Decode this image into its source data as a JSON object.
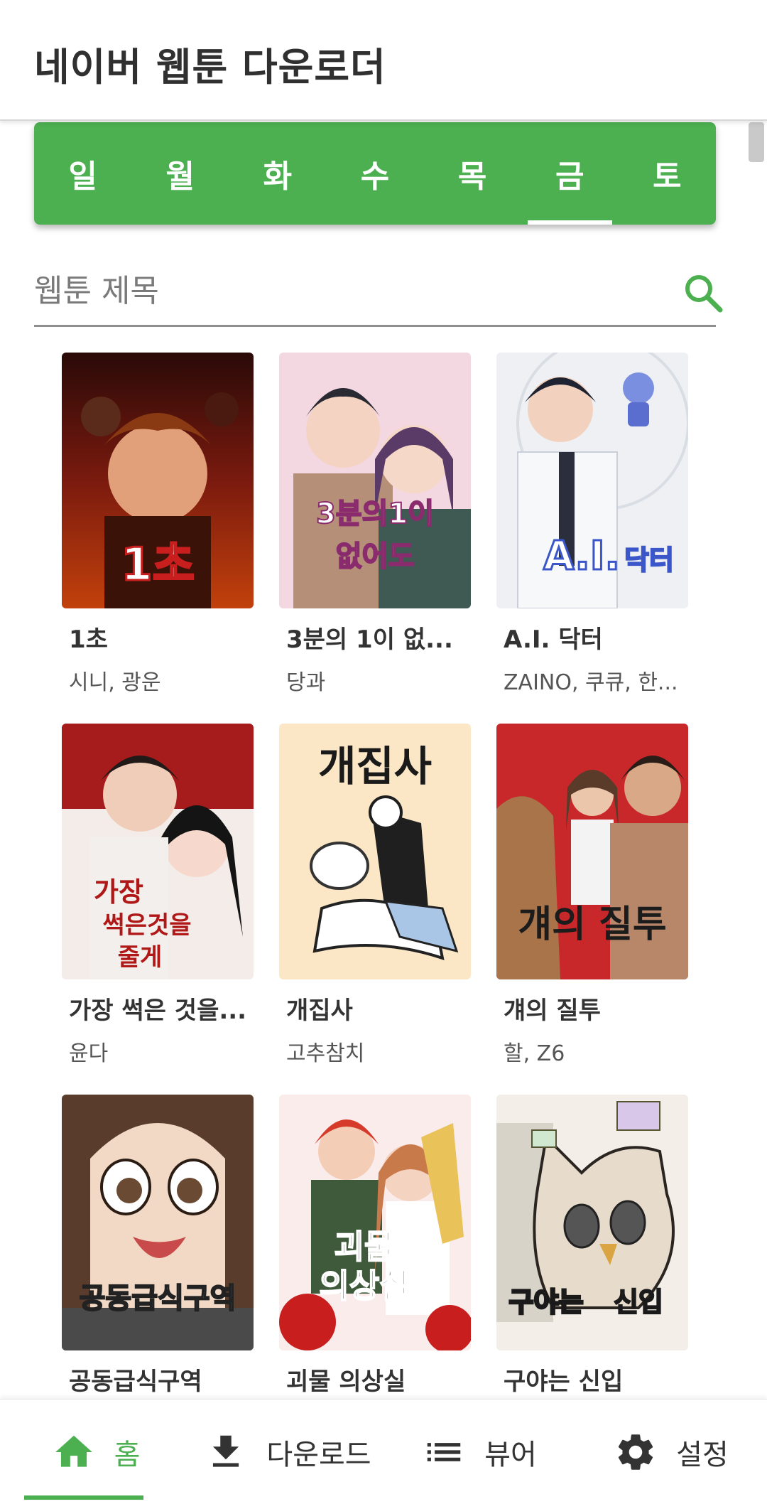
{
  "app_title": "네이버 웹툰 다운로더",
  "day_tabs": [
    {
      "label": "일"
    },
    {
      "label": "월"
    },
    {
      "label": "화"
    },
    {
      "label": "수"
    },
    {
      "label": "목"
    },
    {
      "label": "금",
      "active": true
    },
    {
      "label": "토"
    }
  ],
  "search": {
    "placeholder": "웹툰 제목",
    "value": ""
  },
  "webtoons": [
    {
      "title": "1초",
      "author": "시니, 광운",
      "cover_text": "1초"
    },
    {
      "title": "3분의 1이 없...",
      "author": "당과",
      "cover_text": "3분의 1이 없어도"
    },
    {
      "title": "A.I. 닥터",
      "author": "ZAINO, 쿠큐, 한...",
      "cover_text": "A.I. 닥터"
    },
    {
      "title": "가장 썩은 것을...",
      "author": "윤다",
      "cover_text": "가장 썩은것을 줄게"
    },
    {
      "title": "개집사",
      "author": "고추참치",
      "cover_text": "개집사"
    },
    {
      "title": "걔의 질투",
      "author": "할, Z6",
      "cover_text": "걔의 질투"
    },
    {
      "title": "공동급식구역",
      "author": "",
      "cover_text": "공동급식구역"
    },
    {
      "title": "괴물 의상실",
      "author": "",
      "cover_text": "괴물 의상실"
    },
    {
      "title": "구야는 신입",
      "author": "",
      "cover_text": "구야는 신입"
    }
  ],
  "bottom_nav": [
    {
      "label": "홈",
      "icon": "home-icon",
      "active": true
    },
    {
      "label": "다운로드",
      "icon": "download-icon"
    },
    {
      "label": "뷰어",
      "icon": "list-icon"
    },
    {
      "label": "설정",
      "icon": "gear-icon"
    }
  ],
  "colors": {
    "accent": "#4caf50",
    "text_primary": "#333333",
    "text_secondary": "#555555"
  }
}
